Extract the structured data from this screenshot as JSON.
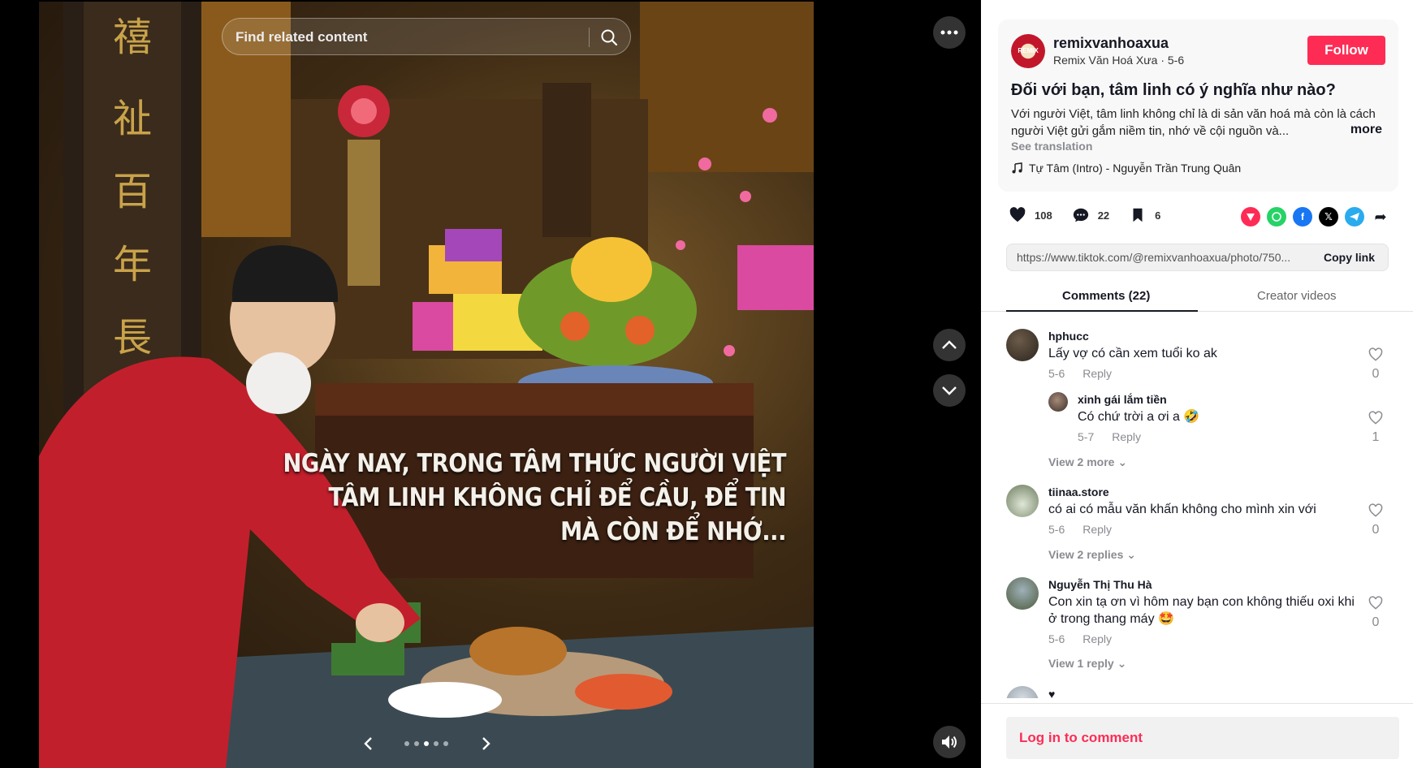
{
  "search": {
    "placeholder": "Find related content"
  },
  "photo": {
    "caption_lines": [
      "NGÀY NAY, TRONG TÂM THỨC NGƯỜI VIỆT",
      "TÂM LINH KHÔNG CHỈ ĐỂ CẦU, ĐỂ TIN",
      "MÀ CÒN ĐỂ NHỚ..."
    ],
    "carousel_total": 5,
    "carousel_active": 3
  },
  "author": {
    "username": "remixvanhoaxua",
    "display_name": "Remix Văn Hoá Xưa",
    "date": "5-6",
    "subline": "Remix Văn Hoá Xưa · 5-6",
    "avatar_text": "REMIX",
    "follow_label": "Follow"
  },
  "post": {
    "title": "Đối với bạn, tâm linh có ý nghĩa như nào?",
    "description": "Với người Việt, tâm linh không chỉ là di sản văn hoá mà còn là cách người Việt gửi gắm niềm tin, nhớ về cội nguồn và...",
    "more_label": "more",
    "see_translation": "See translation",
    "music": "Tự Tâm (Intro) - Nguyễn Trần Trung Quân"
  },
  "stats": {
    "likes": "108",
    "comments": "22",
    "saves": "6"
  },
  "share_icons": [
    "embed-icon",
    "whatsapp-icon",
    "facebook-icon",
    "x-icon",
    "telegram-icon",
    "share-arrow-icon"
  ],
  "link": {
    "url": "https://www.tiktok.com/@remixvanhoaxua/photo/750...",
    "copy_label": "Copy link"
  },
  "tabs": {
    "comments": "Comments (22)",
    "creator": "Creator videos"
  },
  "comments": [
    {
      "user": "hphucc",
      "text": "Lấy vợ có cần xem tuổi ko ak",
      "date": "5-6",
      "reply_label": "Reply",
      "likes": "0",
      "replies": [
        {
          "user": "xinh gái lắm tiền",
          "text": "Có chứ trời a ơi a 🤣",
          "date": "5-7",
          "reply_label": "Reply",
          "likes": "1"
        }
      ],
      "view_more": "View 2 more"
    },
    {
      "user": "tiinaa.store",
      "text": "có ai có mẫu văn khấn không cho mình xin với",
      "date": "5-6",
      "reply_label": "Reply",
      "likes": "0",
      "view_more": "View 2 replies"
    },
    {
      "user": "Nguyễn Thị Thu Hà",
      "text": "Con xin tạ ơn vì hôm nay bạn con không thiếu oxi khi ở trong thang máy 🤩",
      "date": "5-6",
      "reply_label": "Reply",
      "likes": "0",
      "view_more": "View 1 reply"
    },
    {
      "user": "",
      "text": "♥"
    }
  ],
  "login": {
    "label": "Log in to comment"
  },
  "colors": {
    "accent": "#fe2c55",
    "panel_card": "#f8f8f8",
    "muted": "#8a8b91"
  }
}
